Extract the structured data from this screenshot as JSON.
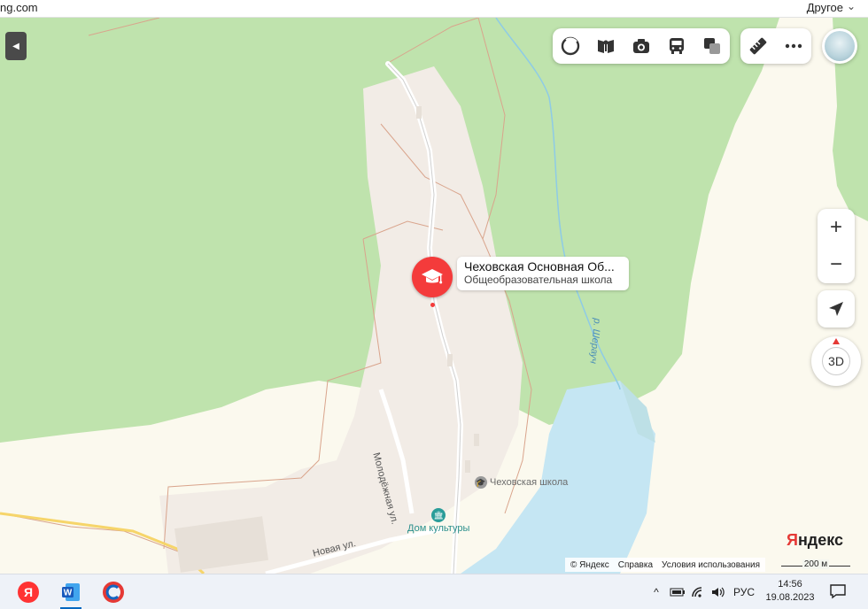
{
  "browser": {
    "url_fragment": "ng.com",
    "other_menu": "Другое",
    "other_chevron": "chevron-down"
  },
  "map": {
    "colors": {
      "forest": "#bfe3ad",
      "settlement": "#f2ece6",
      "field": "#fbf9ee",
      "water": "#c5e6f3",
      "road": "#ffffff",
      "boundary": "#d9a48c",
      "stream": "#8ecbe6"
    },
    "toolbar": {
      "layers": [
        {
          "icon": "layers-scheme-icon",
          "name": "scheme"
        },
        {
          "icon": "panorama-icon",
          "name": "panoramas"
        },
        {
          "icon": "photo-icon",
          "name": "photos"
        },
        {
          "icon": "transit-icon",
          "name": "transport"
        },
        {
          "icon": "overlay-icon",
          "name": "layers"
        }
      ],
      "tools": [
        {
          "icon": "ruler-icon",
          "name": "ruler"
        },
        {
          "icon": "more-icon",
          "name": "more"
        }
      ]
    },
    "zoom_in": "+",
    "zoom_out": "−",
    "compass_label": "3D",
    "selected_place": {
      "name": "Чеховская Основная Об...",
      "category": "Общеобразовательная школа"
    },
    "labels": {
      "street_molodezhnaya": "Молодёжная ул.",
      "street_novaya": "Новая ул.",
      "river": "р. Шерауч"
    },
    "pois": [
      {
        "name": "Чеховская школа",
        "icon": "school-icon"
      },
      {
        "name": "Дом культуры",
        "icon": "museum-icon"
      }
    ],
    "logo": {
      "first": "Я",
      "rest": "ндекс"
    },
    "attribution": {
      "copyright": "© Яндекс",
      "help": "Справка",
      "terms": "Условия использования"
    },
    "scale": "200 м"
  },
  "taskbar": {
    "apps": [
      {
        "name": "yandex-browser",
        "label": "Я",
        "active": false
      },
      {
        "name": "word",
        "label": "W",
        "active": true
      },
      {
        "name": "app-c",
        "label": "C",
        "active": false
      }
    ],
    "language": "РУС",
    "time": "14:56",
    "date": "19.08.2023"
  }
}
